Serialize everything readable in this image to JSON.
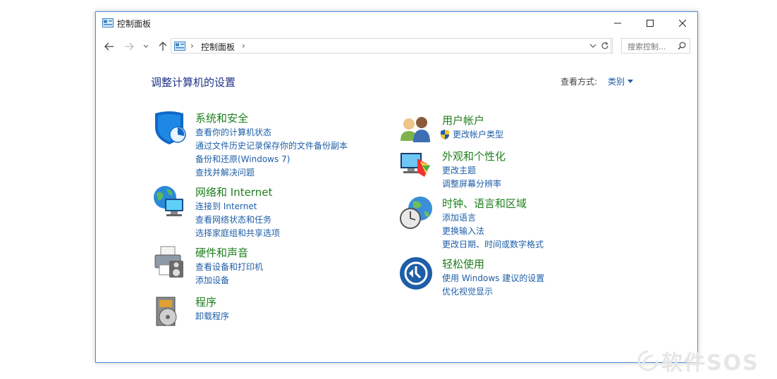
{
  "window": {
    "title": "控制面板",
    "buttons": {
      "minimize": "minimize",
      "maximize": "maximize",
      "close": "close"
    }
  },
  "nav": {
    "address_separator": "›",
    "address_path": "控制面板",
    "search_placeholder": "搜索控制..."
  },
  "header": {
    "title": "调整计算机的设置",
    "view_by_label": "查看方式:",
    "view_by_value": "类别"
  },
  "categories_left": [
    {
      "icon": "shield-icon",
      "title": "系统和安全",
      "links": [
        "查看你的计算机状态",
        "通过文件历史记录保存你的文件备份副本",
        "备份和还原(Windows 7)",
        "查找并解决问题"
      ]
    },
    {
      "icon": "network-globe-icon",
      "title": "网络和 Internet",
      "links": [
        "连接到 Internet",
        "查看网络状态和任务",
        "选择家庭组和共享选项"
      ]
    },
    {
      "icon": "printer-icon",
      "title": "硬件和声音",
      "links": [
        "查看设备和打印机",
        "添加设备"
      ]
    },
    {
      "icon": "programs-icon",
      "title": "程序",
      "links": [
        "卸载程序"
      ]
    }
  ],
  "categories_right": [
    {
      "icon": "users-icon",
      "title": "用户帐户",
      "links": [
        "更改帐户类型"
      ]
    },
    {
      "icon": "monitor-palette-icon",
      "title": "外观和个性化",
      "links": [
        "更改主题",
        "调整屏幕分辨率"
      ]
    },
    {
      "icon": "clock-globe-icon",
      "title": "时钟、语言和区域",
      "links": [
        "添加语言",
        "更换输入法",
        "更改日期、时间或数字格式"
      ]
    },
    {
      "icon": "ease-of-access-icon",
      "title": "轻松使用",
      "links": [
        "使用 Windows 建议的设置",
        "优化视觉显示"
      ]
    }
  ],
  "watermark": {
    "text": "软件SOS"
  },
  "colors": {
    "category_title": "#1e7e1e",
    "link": "#1e5ea8",
    "page_title": "#1e3287",
    "window_border": "#4a90d9"
  }
}
